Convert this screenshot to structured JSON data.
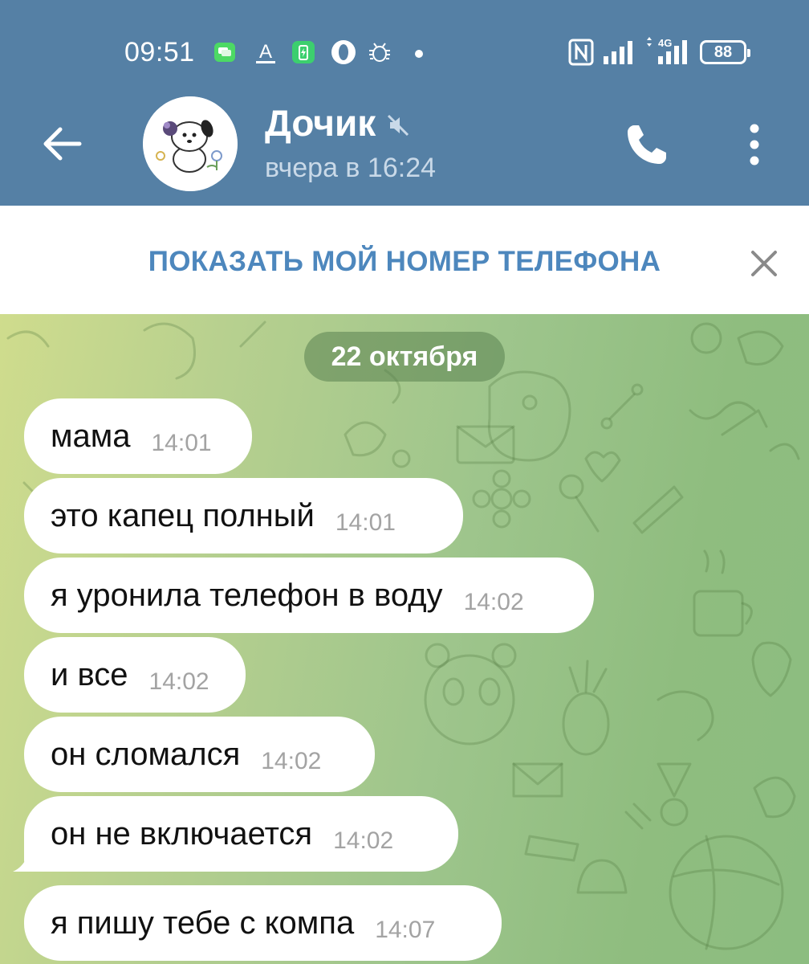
{
  "status_bar": {
    "time": "09:51",
    "battery": "88",
    "network_label": "4G",
    "icons": [
      "messages-icon",
      "text-a-icon",
      "battery-saver-icon",
      "opera-icon",
      "bug-icon",
      "nfc-icon",
      "signal-icon",
      "signal-4g-icon"
    ]
  },
  "header": {
    "title": "Дочик",
    "status": "вчера в 16:24",
    "background_color": "#5580a5"
  },
  "banner": {
    "text": "ПОКАЗАТЬ МОЙ НОМЕР ТЕЛЕФОНА",
    "accent_color": "#4d87bd"
  },
  "chat": {
    "date_separator": "22 октября",
    "messages": [
      {
        "text": "мама",
        "time": "14:01"
      },
      {
        "text": "это капец полный",
        "time": "14:01"
      },
      {
        "text": "я уронила телефон в воду",
        "time": "14:02"
      },
      {
        "text": "и все",
        "time": "14:02"
      },
      {
        "text": "он сломался",
        "time": "14:02"
      },
      {
        "text": "он не включается",
        "time": "14:02"
      },
      {
        "text": "я пишу тебе с компа",
        "time": "14:07"
      }
    ]
  }
}
